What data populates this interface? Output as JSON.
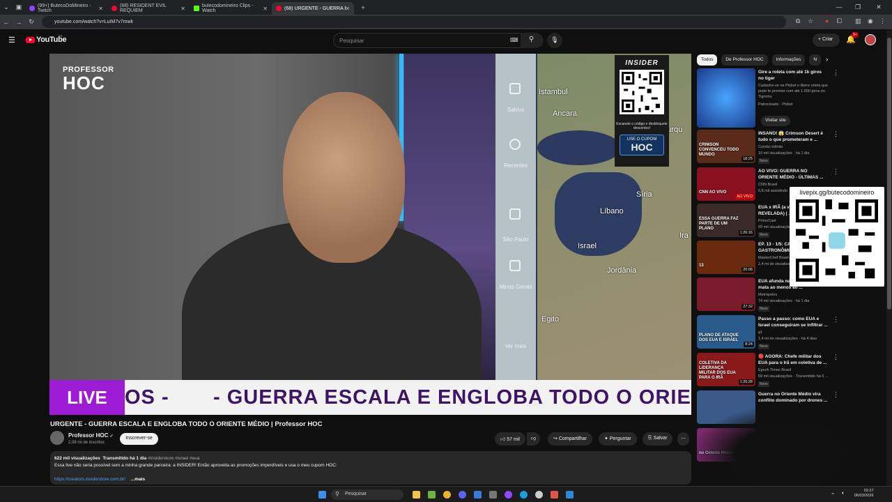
{
  "browser": {
    "tabs": [
      {
        "label": "(99+) ButecoDoMineiro - Twitch",
        "color": "#9146ff"
      },
      {
        "label": "(68) RESIDENT EVIL REQUIEM",
        "color": "#ff0033"
      },
      {
        "label": "butecodomineiro Clips - Watch",
        "color": "#53fc18"
      },
      {
        "label": "(68) URGENTE - GUERRA ESCALA",
        "color": "#ff0033"
      }
    ],
    "url": "youtube.com/watch?v=LuIM7v7mwk"
  },
  "youtube": {
    "logo_text": "YouTube",
    "logo_region": "BR",
    "search_placeholder": "Pesquisar",
    "create_label": "+ Criar",
    "notif_badge": "9+"
  },
  "player": {
    "brand_line1": "PROFESSOR",
    "brand_line2": "HOC",
    "live_label": "LIVE",
    "ticker_text": "OS -       - GUERRA ESCALA E ENGLOBA TODO O ORIENTE",
    "map_labels": [
      "Istambul",
      "Ancara",
      "Turqu",
      "Síria",
      "Líbano",
      "Israel",
      "Jordânia",
      "Egito",
      "Ira"
    ],
    "map_side": [
      "Salvos",
      "Recentes",
      "São Paulo",
      "Minas Gerais",
      "Ver mais"
    ],
    "promo": {
      "brand": "INSIDER",
      "text": "Escaneie o código e desbloqueie descontos!",
      "coupon_label": "USE O CUPOM",
      "coupon_code": "HOC"
    }
  },
  "video": {
    "title": "URGENTE - GUERRA ESCALA E ENGLOBA TODO O ORIENTE MÉDIO | Professor HOC",
    "channel": "Professor HOC",
    "subscribers": "2,08 mi de inscritos",
    "subscribe_label": "Inscrever-se",
    "likes": "57 mil",
    "share_label": "Compartilhar",
    "ask_label": "Perguntar",
    "save_label": "Salvar",
    "stats": "622 mil visualizações  Transmitido há 1 dia",
    "tags": "#insiderstore #israel #eua",
    "description": "Essa live não seria possível sem a minha grande parceira: a INSIDER! Então aproveita as promoções imperdíveis e usa o meu cupom HOC:",
    "link": "https://creators.insiderstore.com.br/",
    "more_label": "...mais"
  },
  "chips": [
    "Todos",
    "De Professor HOC",
    "Informações",
    "N"
  ],
  "ad": {
    "title": "Gire a roleta com até 1k giros no tiger",
    "desc": "Cadastre-se na Pixbet e libere roleta que pode te premiar com até 1.000 giros no Tigrinho",
    "sponsor": "Patrocinado · Pixbet",
    "cta": "Visitar site"
  },
  "recs": [
    {
      "title": "INSANO! 😱 Crimson Desert é tudo o que prometeram e ...",
      "channel": "Combo Infinito",
      "views": "10 mil visualizações · há 1 dia",
      "dur": "18:25",
      "badge": "Novo",
      "thumb": "#5a2a1a",
      "label": "CRIMSON CONVENCEU TODO MUNDO"
    },
    {
      "title": "AO VIVO: GUERRA NO ORIENTE MÉDIO - ÚLTIMAS ...",
      "channel": "CNN Brasil",
      "views": "6,8 mil assistindo",
      "dur": "AO VIVO",
      "badge": "",
      "thumb": "#8a1020",
      "label": "CNN AO VIVO"
    },
    {
      "title": "EUA x IRÃ (a verdade REVELADA) | ...",
      "channel": "PrimoCast",
      "views": "69 mil visualizações",
      "dur": "1:26:16",
      "badge": "Novo",
      "thumb": "#3a2a2a",
      "label": "ESSA GUERRA FAZ PARTE DE UM PLANO"
    },
    {
      "title": "EP. 13 - 1/5: CAIXA GASTRONÔMICA ...",
      "channel": "MasterChef Brasil",
      "views": "2,4 mi de visualizações",
      "dur": "20:06",
      "badge": "",
      "thumb": "#6a2a10",
      "label": "13"
    },
    {
      "title": "EUA afunda navio iraniano e mata ao menos 80 ...",
      "channel": "Metrópoles",
      "views": "74 mil visualizações · há 1 dia",
      "dur": "27:32",
      "badge": "Novo",
      "thumb": "#7a1a2a",
      "label": ""
    },
    {
      "title": "Passo a passo: como EUA e Israel conseguiram se infiltrar ...",
      "channel": "g1",
      "views": "1,4 mi de visualizações · há 4 dias",
      "dur": "8:24",
      "badge": "Novo",
      "thumb": "#2a5a8a",
      "label": "PLANO DE ATAQUE DOS EUA E ISRAEL"
    },
    {
      "title": "🔴 AGORA: Chefe militar dos EUA para o Irã em coletiva de ...",
      "channel": "Epoch Times Brasil",
      "views": "59 mil visualizações · Transmitido há 6 ...",
      "dur": "1:26:28",
      "badge": "Novo",
      "thumb": "#8a1a1a",
      "label": "COLETIVA DA LIDERANÇA MILITAR DOS EUA PARA O IRÃ"
    },
    {
      "title": "Guerra no Oriente Médio vira conflito dominado por drones ...",
      "channel": "",
      "views": "",
      "dur": "",
      "badge": "",
      "thumb": "#3a5a8a",
      "label": ""
    },
    {
      "title": "",
      "channel": "",
      "views": "",
      "dur": "",
      "badge": "",
      "thumb": "#7a2a6a",
      "label": "no Oriente Médio"
    }
  ],
  "overlay": {
    "url": "livepix.gg/butecodomineiro"
  },
  "taskbar": {
    "search": "Pesquisar",
    "time": "02:27",
    "date": "06/03/2026"
  }
}
